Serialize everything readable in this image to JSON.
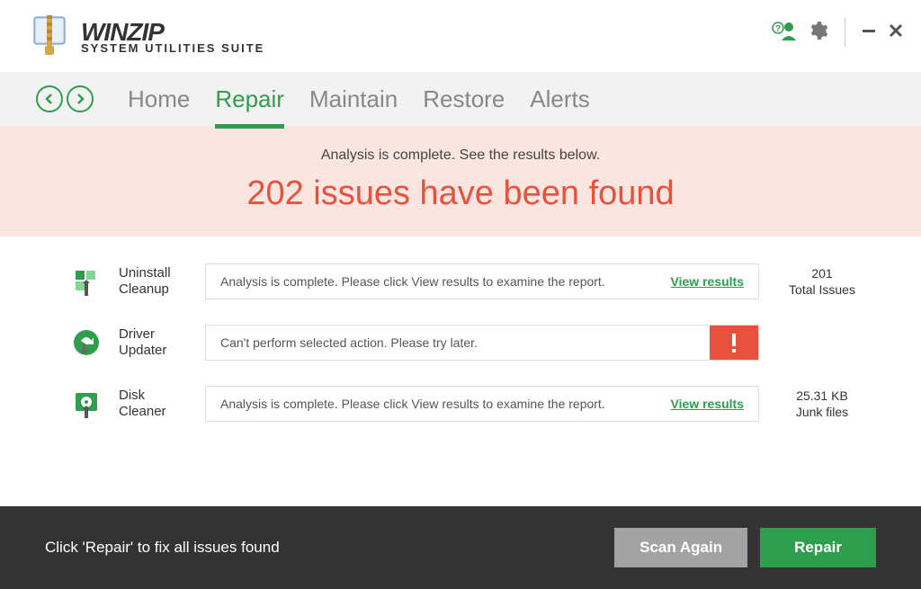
{
  "brand": {
    "main": "WINZIP",
    "sub": "SYSTEM UTILITIES SUITE"
  },
  "nav": {
    "items": [
      {
        "label": "Home"
      },
      {
        "label": "Repair"
      },
      {
        "label": "Maintain"
      },
      {
        "label": "Restore"
      },
      {
        "label": "Alerts"
      }
    ]
  },
  "banner": {
    "sub": "Analysis is complete. See the results below.",
    "main": "202 issues have been found"
  },
  "results": {
    "uninstall": {
      "label": "Uninstall Cleanup",
      "message": "Analysis is complete. Please click View results to examine the report.",
      "action": "View results",
      "stat_value": "201",
      "stat_label": "Total Issues"
    },
    "driver": {
      "label": "Driver Updater",
      "message": "Can't perform selected action. Please try later."
    },
    "disk": {
      "label": "Disk Cleaner",
      "message": "Analysis is complete. Please click View results to examine the report.",
      "action": "View results",
      "stat_value": "25.31 KB",
      "stat_label": "Junk files"
    }
  },
  "footer": {
    "text": "Click 'Repair' to fix all issues found",
    "scan_label": "Scan Again",
    "repair_label": "Repair"
  }
}
